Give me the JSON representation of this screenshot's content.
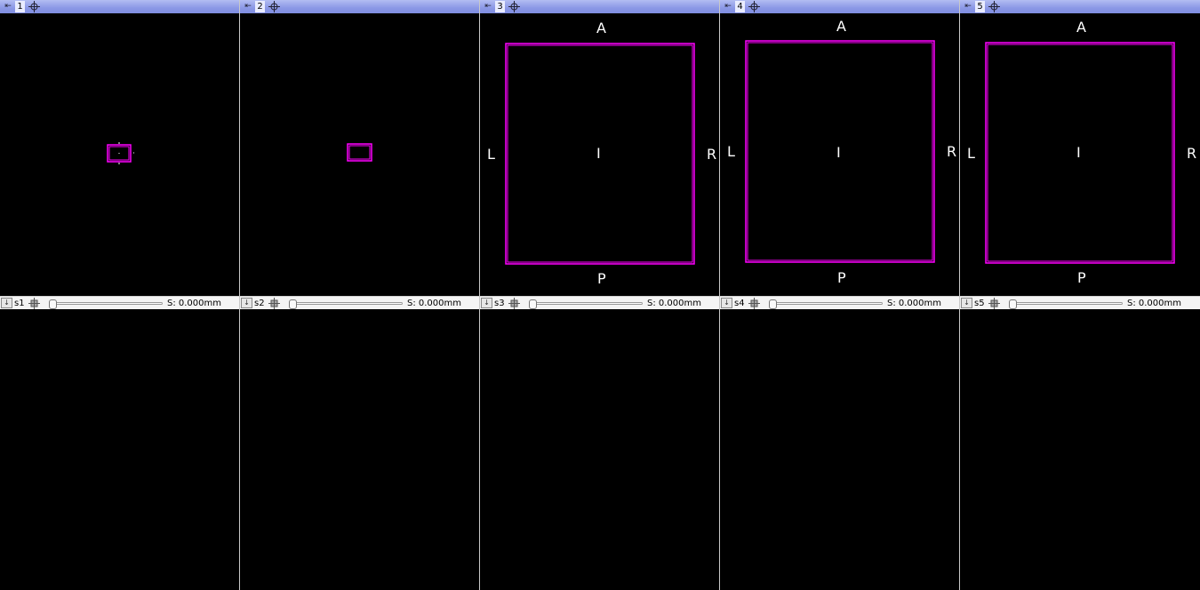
{
  "colors": {
    "titlebar": "#8b98e6",
    "outline": "#ff00ff",
    "background": "#000000"
  },
  "panels": [
    {
      "id": "1",
      "slice_name": "s1",
      "slice_value": "S: 0.000mm",
      "orientation": {
        "top": "",
        "bottom": "",
        "left": "",
        "right": "",
        "center": ""
      }
    },
    {
      "id": "2",
      "slice_name": "s2",
      "slice_value": "S: 0.000mm",
      "orientation": {
        "top": "",
        "bottom": "",
        "left": "",
        "right": "",
        "center": ""
      }
    },
    {
      "id": "3",
      "slice_name": "s3",
      "slice_value": "S: 0.000mm",
      "orientation": {
        "top": "A",
        "bottom": "P",
        "left": "L",
        "right": "R",
        "center": "I"
      }
    },
    {
      "id": "4",
      "slice_name": "s4",
      "slice_value": "S: 0.000mm",
      "orientation": {
        "top": "A",
        "bottom": "P",
        "left": "L",
        "right": "R",
        "center": "I"
      }
    },
    {
      "id": "5",
      "slice_name": "s5",
      "slice_value": "S: 0.000mm",
      "orientation": {
        "top": "A",
        "bottom": "P",
        "left": "L",
        "right": "R",
        "center": "I"
      }
    }
  ],
  "icons": {
    "pin": "pin-icon",
    "crosshair": "crosshair-icon",
    "link": "link-icon"
  }
}
